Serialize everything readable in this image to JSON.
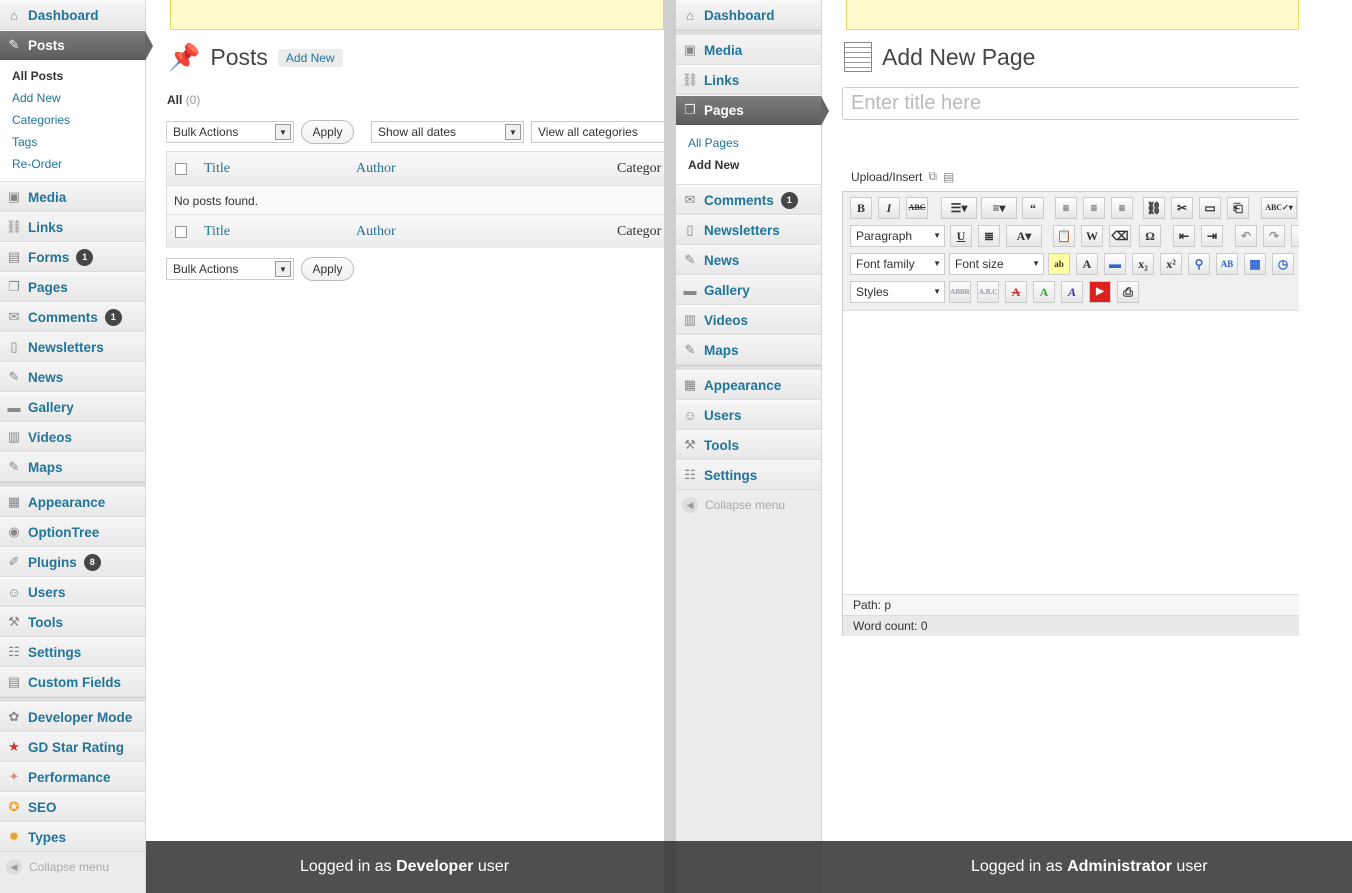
{
  "left": {
    "menu_top": [
      {
        "label": "Dashboard",
        "icon": "home-icon"
      },
      {
        "label": "Posts",
        "icon": "pin-icon",
        "active": true
      }
    ],
    "posts_submenu": [
      "All Posts",
      "Add New",
      "Categories",
      "Tags",
      "Re-Order"
    ],
    "menu_mid": [
      {
        "label": "Media",
        "icon": "media-icon"
      },
      {
        "label": "Links",
        "icon": "link-icon"
      },
      {
        "label": "Forms",
        "icon": "forms-icon",
        "badge": "1"
      },
      {
        "label": "Pages",
        "icon": "pages-icon"
      },
      {
        "label": "Comments",
        "icon": "comment-icon",
        "badge": "1"
      },
      {
        "label": "Newsletters",
        "icon": "newsletter-icon"
      },
      {
        "label": "News",
        "icon": "pin-icon"
      },
      {
        "label": "Gallery",
        "icon": "gallery-icon"
      },
      {
        "label": "Videos",
        "icon": "film-icon"
      },
      {
        "label": "Maps",
        "icon": "pin-icon"
      }
    ],
    "menu_bottom": [
      {
        "label": "Appearance",
        "icon": "appearance-icon"
      },
      {
        "label": "OptionTree",
        "icon": "optiontree-icon"
      },
      {
        "label": "Plugins",
        "icon": "plug-icon",
        "badge": "8"
      },
      {
        "label": "Users",
        "icon": "users-icon"
      },
      {
        "label": "Tools",
        "icon": "tools-icon"
      },
      {
        "label": "Settings",
        "icon": "settings-icon"
      },
      {
        "label": "Custom Fields",
        "icon": "custom-fields-icon"
      }
    ],
    "menu_extra": [
      {
        "label": "Developer Mode",
        "icon": "gear-icon"
      },
      {
        "label": "GD Star Rating",
        "icon": "star-icon"
      },
      {
        "label": "Performance",
        "icon": "performance-icon"
      },
      {
        "label": "SEO",
        "icon": "seo-icon"
      },
      {
        "label": "Types",
        "icon": "types-icon"
      }
    ],
    "collapse_label": "Collapse menu",
    "page_title": "Posts",
    "add_new": "Add New",
    "filter_all": "All",
    "filter_count": "(0)",
    "bulk_actions": "Bulk Actions",
    "apply": "Apply",
    "dates": "Show all dates",
    "categories": "View all categories",
    "col_title": "Title",
    "col_author": "Author",
    "col_categories": "Categor",
    "no_posts": "No posts found.",
    "footer": {
      "prefix": "Logged in as ",
      "role": "Developer",
      "suffix": " user"
    }
  },
  "right": {
    "menu_top": [
      {
        "label": "Dashboard",
        "icon": "home-icon"
      }
    ],
    "menu_mid": [
      {
        "label": "Media",
        "icon": "media-icon"
      },
      {
        "label": "Links",
        "icon": "link-icon"
      },
      {
        "label": "Pages",
        "icon": "pages-icon",
        "active": true
      }
    ],
    "pages_submenu": [
      "All Pages",
      "Add New"
    ],
    "menu_after": [
      {
        "label": "Comments",
        "icon": "comment-icon",
        "badge": "1"
      },
      {
        "label": "Newsletters",
        "icon": "newsletter-icon"
      },
      {
        "label": "News",
        "icon": "pin-icon"
      },
      {
        "label": "Gallery",
        "icon": "gallery-icon"
      },
      {
        "label": "Videos",
        "icon": "film-icon"
      },
      {
        "label": "Maps",
        "icon": "pin-icon"
      }
    ],
    "menu_bottom": [
      {
        "label": "Appearance",
        "icon": "appearance-icon"
      },
      {
        "label": "Users",
        "icon": "users-icon"
      },
      {
        "label": "Tools",
        "icon": "tools-icon"
      },
      {
        "label": "Settings",
        "icon": "settings-icon"
      }
    ],
    "collapse_label": "Collapse menu",
    "page_title": "Add New Page",
    "title_placeholder": "Enter title here",
    "upload_insert": "Upload/Insert",
    "format_select": "Paragraph",
    "font_family": "Font family",
    "font_size": "Font size",
    "styles": "Styles",
    "path_label": "Path:",
    "path_value": "p",
    "word_count_label": "Word count:",
    "word_count_value": "0",
    "footer": {
      "prefix": "Logged in as ",
      "role": "Administrator",
      "suffix": " user"
    }
  }
}
